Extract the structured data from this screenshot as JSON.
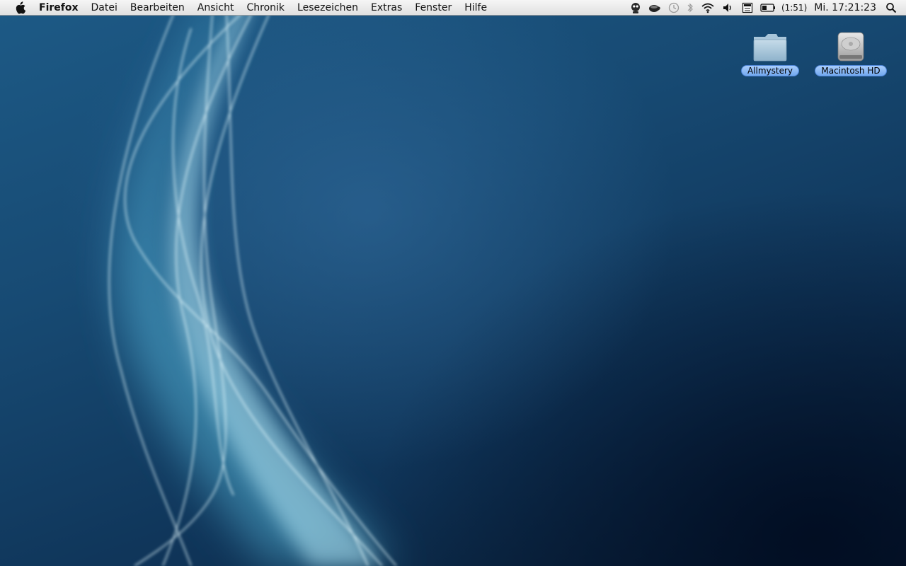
{
  "menubar": {
    "app_name": "Firefox",
    "menus": [
      "Datei",
      "Bearbeiten",
      "Ansicht",
      "Chronik",
      "Lesezeichen",
      "Extras",
      "Fenster",
      "Hilfe"
    ],
    "status_icons": [
      "growl-icon",
      "coffee-icon",
      "time-machine-icon",
      "bluetooth-icon",
      "wifi-icon",
      "volume-icon",
      "keyboard-input-icon",
      "battery-icon"
    ],
    "battery_time": "(1:51)",
    "clock": "Mi. 17:21:23"
  },
  "desktop": {
    "icons": [
      {
        "label": "Allmystery",
        "icon": "folder-icon"
      },
      {
        "label": "Macintosh HD",
        "icon": "hard-drive-icon"
      }
    ]
  },
  "colors": {
    "wallpaper_dark": "#0f3458",
    "wallpaper_light": "#1d5a86",
    "aurora": "#9fe8ff",
    "label_selection": "#72a8ef"
  }
}
